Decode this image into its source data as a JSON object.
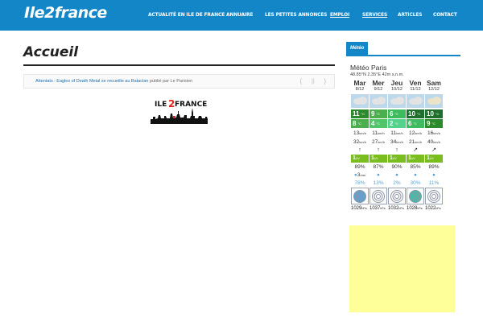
{
  "header": {
    "logo": "Ile2france",
    "nav": [
      {
        "label": "ACTUALITÉ EN ILE DE FRANCE"
      },
      {
        "label": "ANNUAIRE"
      },
      {
        "label": "LES PETITES ANNONCES"
      },
      {
        "label": "EMPLOI"
      },
      {
        "label": "SERVICES"
      },
      {
        "label": "ARTICLES"
      },
      {
        "label": "CONTACT"
      }
    ]
  },
  "main": {
    "title": "Accueil",
    "ticker": {
      "link": "Attentats : Eagles of Death Metal se recueille au Bataclan",
      "suffix": "publié par Le Parisien",
      "prev": "⟨",
      "pause": "||",
      "next": "⟩"
    },
    "site_logo": {
      "text_left": "ILE",
      "text_mid": "2",
      "text_right": "FRANCE"
    }
  },
  "sidebar": {
    "tab": "Météo",
    "title": "Météo Paris",
    "coords": "48.85°N 2.35°E 42m s.n.m.",
    "units": {
      "temp": "°C",
      "wind": "km/h",
      "uv": "UV",
      "rain": "mm",
      "pressure": "hPa"
    },
    "days": [
      {
        "name": "Mar",
        "date": "8/12",
        "max": "11",
        "min": "8",
        "wind": "13",
        "gust": "32",
        "uv": "1",
        "humidity": "89%",
        "rain": "3",
        "prob": "78%",
        "pressure": "1029",
        "max_color": "#2b8a2b",
        "min_color": "#4cae4c"
      },
      {
        "name": "Mer",
        "date": "9/12",
        "max": "9",
        "min": "4",
        "wind": "11",
        "gust": "27",
        "uv": "1",
        "humidity": "87%",
        "rain": "",
        "prob": "13%",
        "pressure": "1037",
        "max_color": "#4cae4c",
        "min_color": "#52c46a"
      },
      {
        "name": "Jeu",
        "date": "10/12",
        "max": "6",
        "min": "2",
        "wind": "11",
        "gust": "34",
        "uv": "1",
        "humidity": "90%",
        "rain": "",
        "prob": "2%",
        "pressure": "1032",
        "max_color": "#3dbb5e",
        "min_color": "#54d18a"
      },
      {
        "name": "Ven",
        "date": "11/12",
        "max": "10",
        "min": "6",
        "wind": "12",
        "gust": "21",
        "uv": "1",
        "humidity": "85%",
        "rain": "",
        "prob": "30%",
        "pressure": "1028",
        "max_color": "#1f6e2b",
        "min_color": "#3dbb5e"
      },
      {
        "name": "Sam",
        "date": "12/12",
        "max": "10",
        "min": "9",
        "wind": "16",
        "gust": "40",
        "uv": "1",
        "humidity": "89%",
        "rain": "",
        "prob": "11%",
        "pressure": "1022",
        "max_color": "#1f6e2b",
        "min_color": "#2b8a2b"
      }
    ]
  },
  "colors": {
    "brand": "#1386c8",
    "ad_background": "#ffff99",
    "uv_green": "#7abd1f"
  }
}
